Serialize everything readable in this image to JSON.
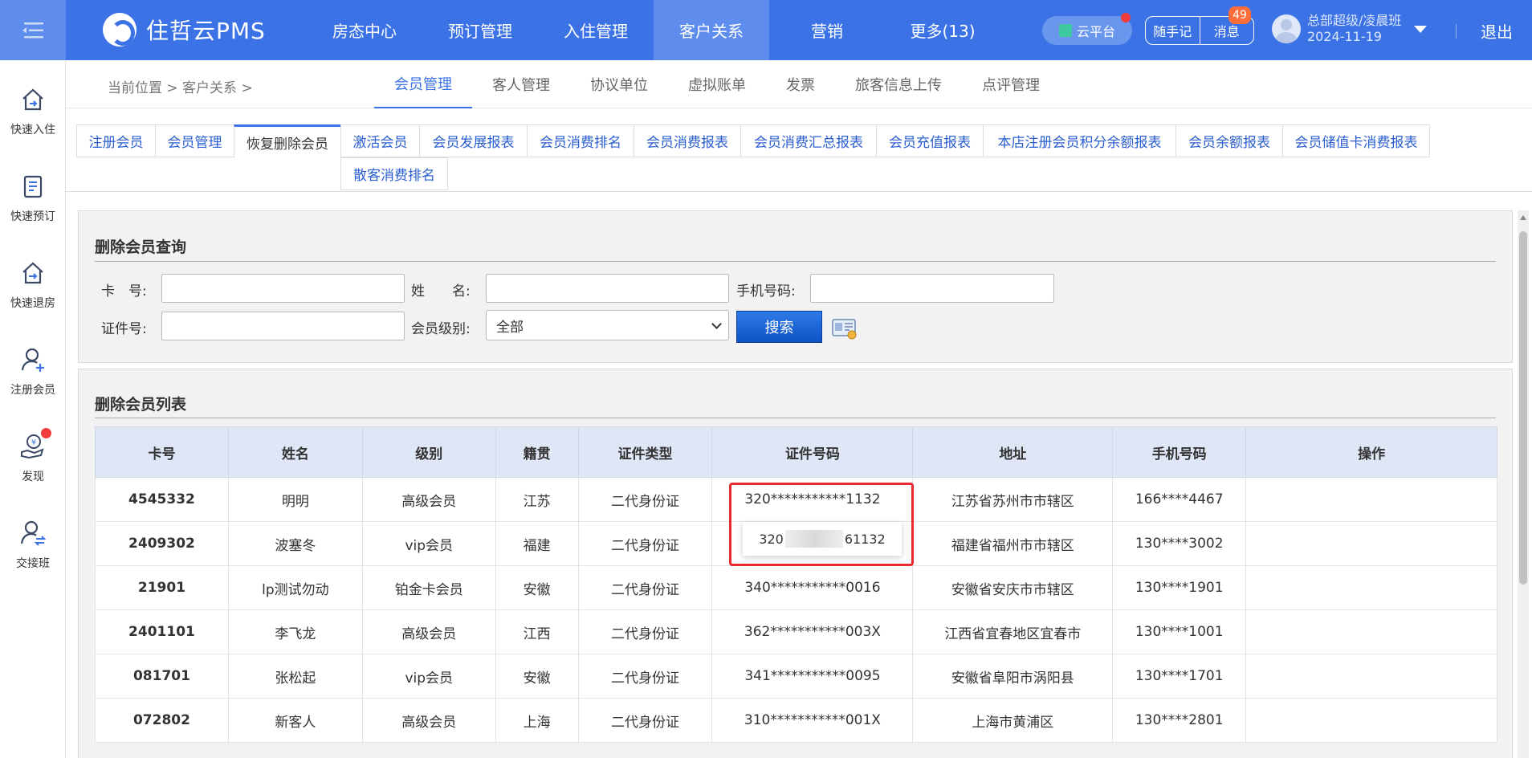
{
  "header": {
    "brand": "住哲云PMS",
    "nav": [
      "房态中心",
      "预订管理",
      "入住管理",
      "客户关系",
      "营销",
      "更多(13)"
    ],
    "cloud_label": "云平台",
    "note_label": "随手记",
    "message_label": "消息",
    "message_count": "49",
    "user_name": "总部超级/凌晨班",
    "user_date": "2024-11-19",
    "logout_label": "退出"
  },
  "sidebar": {
    "items": [
      "快速入住",
      "快速预订",
      "快速退房",
      "注册会员",
      "发现",
      "交接班"
    ]
  },
  "subnav": {
    "breadcrumb": "当前位置 > 客户关系 >",
    "tabs": [
      "会员管理",
      "客人管理",
      "协议单位",
      "虚拟账单",
      "发票",
      "旅客信息上传",
      "点评管理"
    ]
  },
  "function_tabs": [
    "注册会员",
    "会员管理",
    "恢复删除会员",
    "激活会员",
    "会员发展报表",
    "会员消费排名",
    "会员消费报表",
    "会员消费汇总报表",
    "会员充值报表",
    "本店注册会员积分余额报表",
    "会员余额报表",
    "会员储值卡消费报表",
    "散客消费排名"
  ],
  "query": {
    "title": "删除会员查询",
    "card_label": "卡　号:",
    "name_label": "姓　　名:",
    "phone_label": "手机号码:",
    "id_label": "证件号:",
    "level_label": "会员级别:",
    "level_value": "全部",
    "search_label": "搜索"
  },
  "list": {
    "title": "删除会员列表",
    "columns": [
      "卡号",
      "姓名",
      "级别",
      "籍贯",
      "证件类型",
      "证件号码",
      "地址",
      "手机号码",
      "操作"
    ],
    "rows": [
      [
        "4545332",
        "明明",
        "高级会员",
        "江苏",
        "二代身份证",
        "320***********1132",
        "江苏省苏州市市辖区",
        "166****4467",
        ""
      ],
      [
        "2409302",
        "波塞冬",
        "vip会员",
        "福建",
        "二代身份证",
        "",
        "福建省福州市市辖区",
        "130****3002",
        ""
      ],
      [
        "21901",
        "lp测试勿动",
        "铂金卡会员",
        "安徽",
        "二代身份证",
        "340***********0016",
        "安徽省安庆市市辖区",
        "130****1901",
        ""
      ],
      [
        "2401101",
        "李飞龙",
        "高级会员",
        "江西",
        "二代身份证",
        "362***********003X",
        "江西省宜春地区宜春市",
        "130****1001",
        ""
      ],
      [
        "081701",
        "张松起",
        "vip会员",
        "安徽",
        "二代身份证",
        "341***********0095",
        "安徽省阜阳市涡阳县",
        "130****1701",
        ""
      ],
      [
        "072802",
        "新客人",
        "高级会员",
        "上海",
        "二代身份证",
        "310***********001X",
        "上海市黄浦区",
        "130****2801",
        ""
      ]
    ]
  },
  "tooltip": {
    "prefix": "320",
    "suffix": "61132"
  }
}
